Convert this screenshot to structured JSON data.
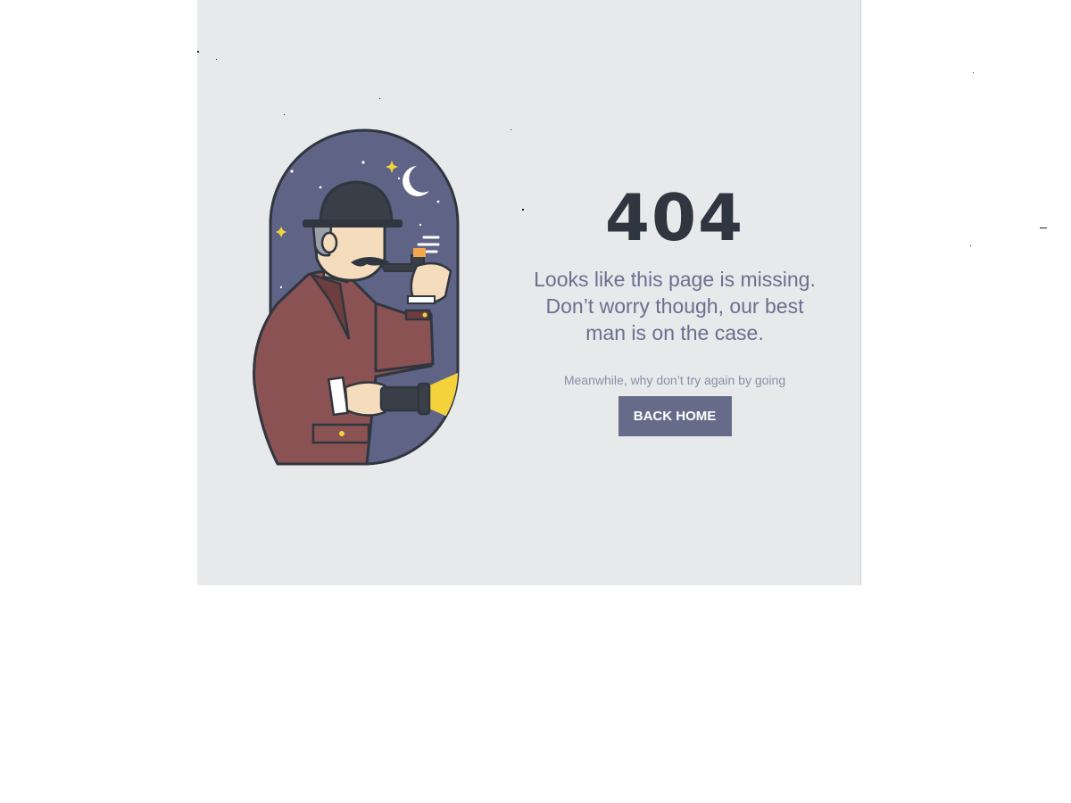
{
  "error": {
    "code": "404",
    "message_lines": [
      "Looks like this page is missing.",
      "Don’t worry though, our best",
      "man is on the case."
    ],
    "hint": "Meanwhile, why don’t try again by going",
    "button_label": "BACK HOME"
  },
  "illustration": {
    "subject": "detective-with-pipe-and-flashlight",
    "colors": {
      "sky": "#5f6385",
      "coat": "#8a5252",
      "outline": "#2f363f",
      "skin": "#f4dcbc",
      "hat": "#3a3f47",
      "moon": "#ffffff",
      "light": "#f3d23b"
    }
  },
  "colors": {
    "panel_bg": "#e8e9eb",
    "heading": "#2f363f",
    "text": "#6c6f8f",
    "button_bg": "#676b8a",
    "button_text": "#ffffff"
  }
}
